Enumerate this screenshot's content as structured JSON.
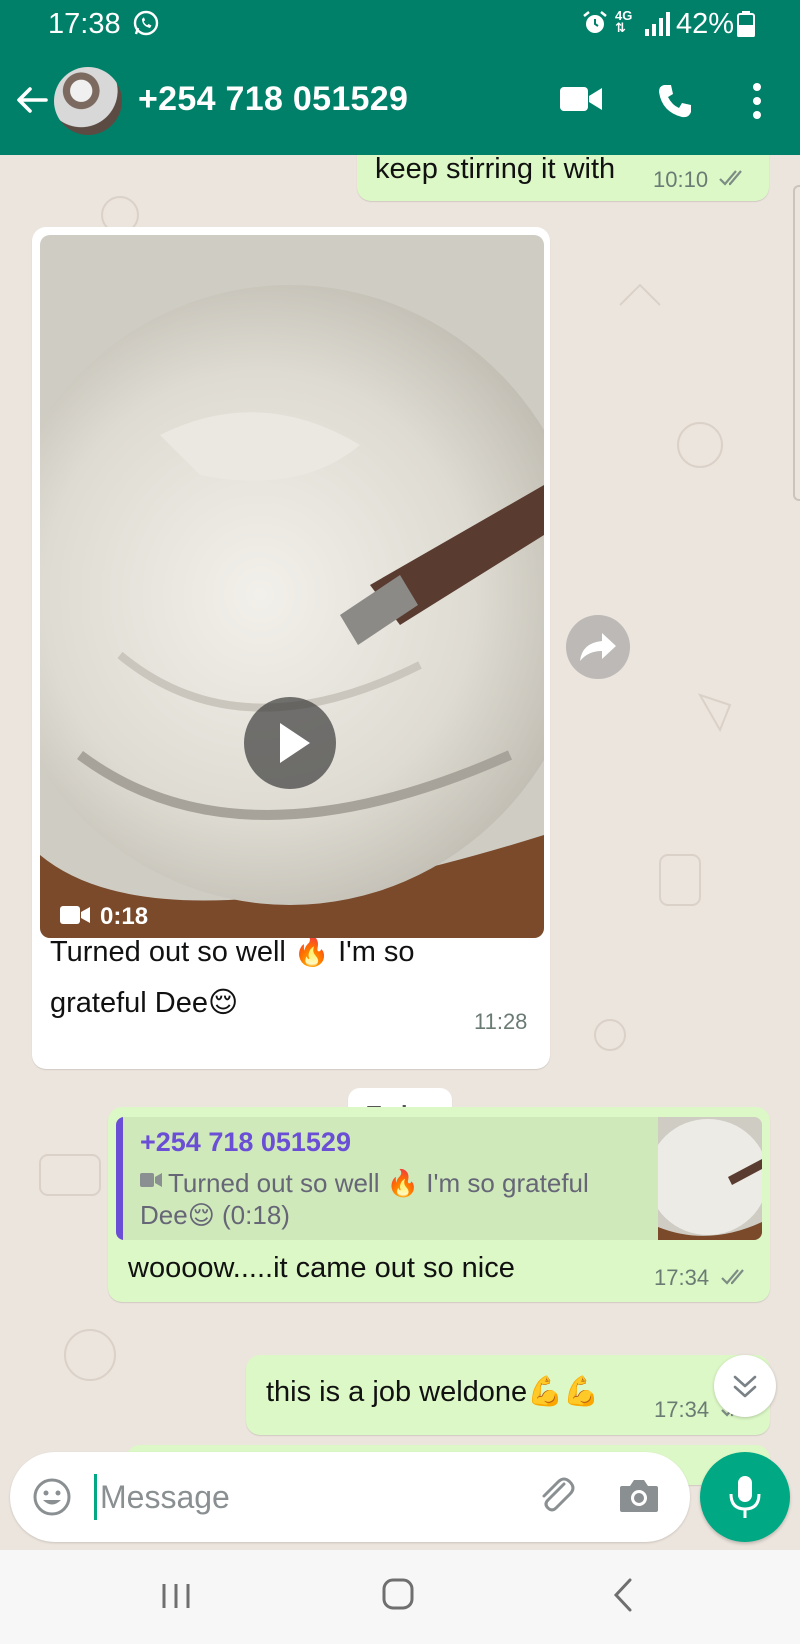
{
  "status_bar": {
    "time": "17:38",
    "network": "4G",
    "battery": "42%"
  },
  "header": {
    "contact": "+254 718 051529"
  },
  "chat": {
    "messages": [
      {
        "direction": "outgoing",
        "text": "keep stirring it with",
        "time": "10:10",
        "read": true
      },
      {
        "direction": "incoming",
        "type": "video",
        "duration": "0:18",
        "caption_line1": "Turned out so well 🔥 I'm so",
        "caption_line2": "grateful Dee😌",
        "time": "11:28"
      },
      {
        "direction": "outgoing",
        "text": "woooow.....it came out so nice",
        "time": "17:34",
        "read": true,
        "quote": {
          "author": "+254 718 051529",
          "line1": "Turned out so well 🔥 I'm so grateful",
          "line2": "Dee😌 (0:18)"
        }
      },
      {
        "direction": "outgoing",
        "text": "this is a job weldone💪💪",
        "time": "17:34",
        "read": true
      }
    ],
    "date_divider": "Today"
  },
  "composer": {
    "placeholder": "Message"
  },
  "colors": {
    "header": "#008069",
    "outgoing_bubble": "#dcf8c6",
    "incoming_bubble": "#ffffff",
    "accent": "#00a884",
    "quote_author": "#6b4ed6"
  },
  "icons": [
    "whatsapp-icon",
    "alarm-icon",
    "signal-icon",
    "battery-icon",
    "back-arrow-icon",
    "video-call-icon",
    "phone-icon",
    "more-icon",
    "play-icon",
    "forward-icon",
    "video-camera-icon",
    "double-check-icon",
    "chevrons-down-icon",
    "emoji-icon",
    "attach-icon",
    "camera-icon",
    "mic-icon",
    "recent-apps-icon",
    "home-icon",
    "nav-back-icon"
  ]
}
